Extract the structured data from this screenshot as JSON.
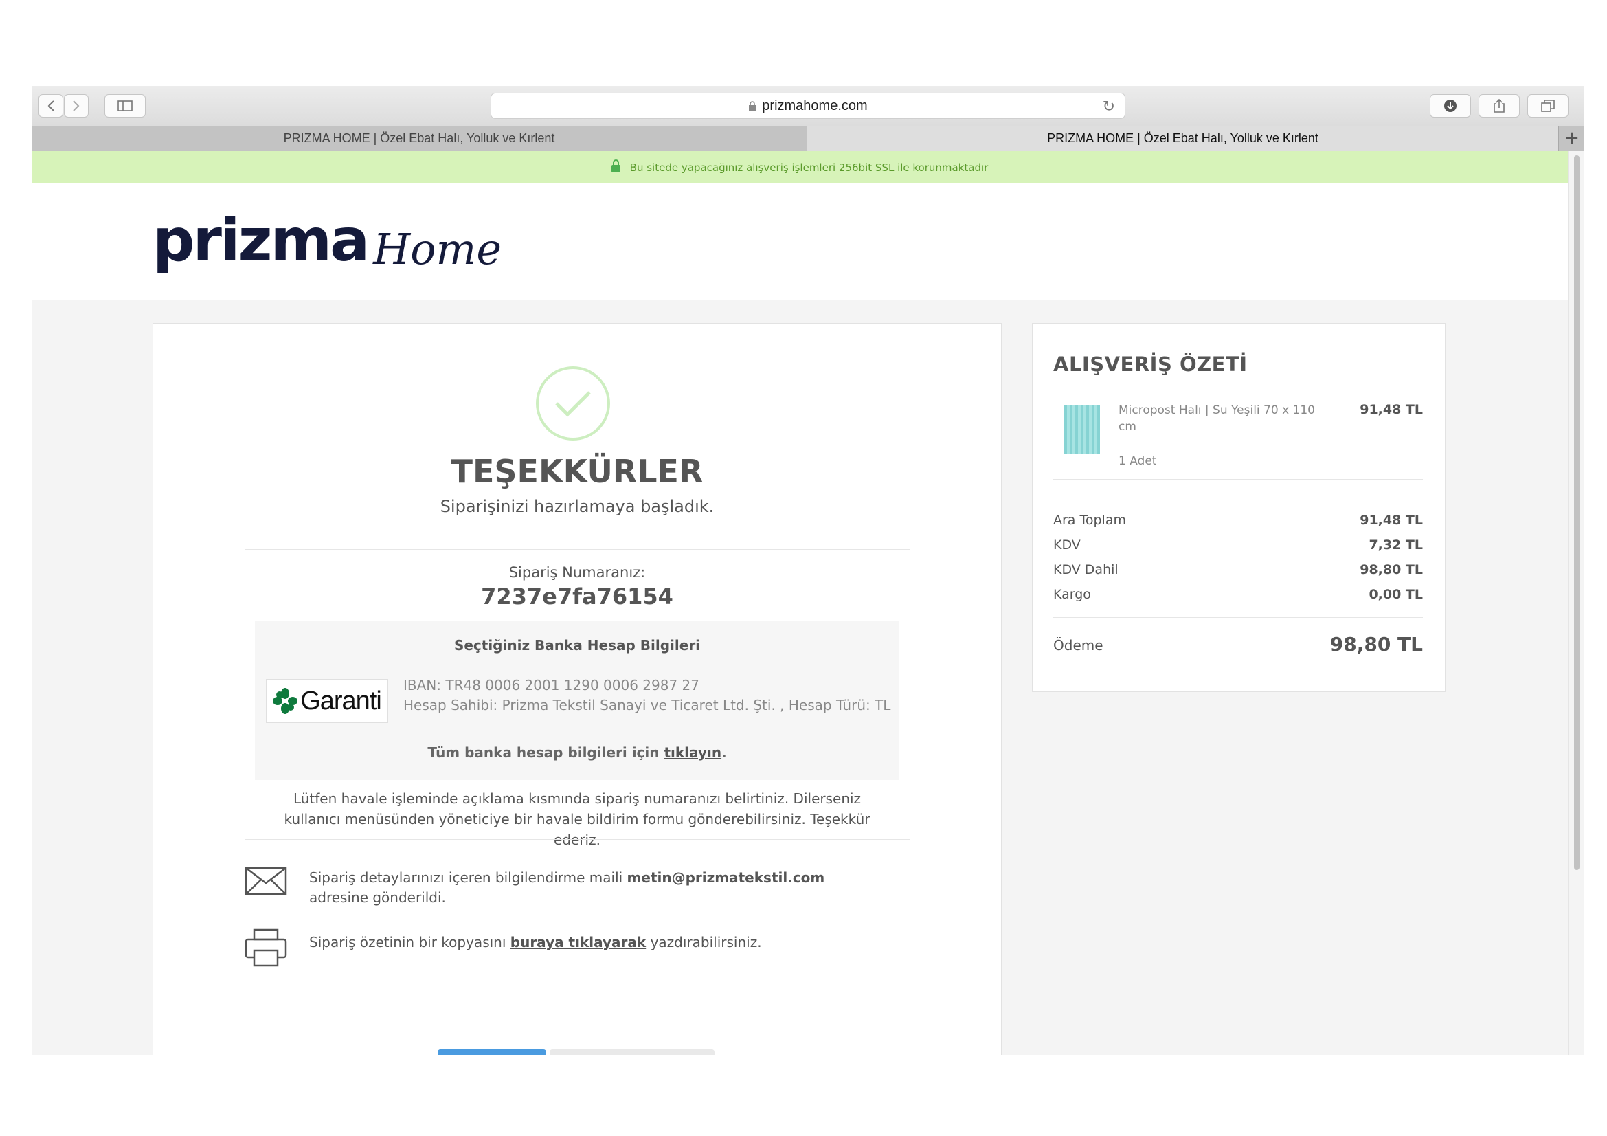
{
  "browser": {
    "url": "prizmahome.com",
    "tabs": [
      {
        "title": "PRIZMA HOME | Özel Ebat Halı, Yolluk ve Kırlent",
        "active": false
      },
      {
        "title": "PRIZMA HOME | Özel Ebat Halı, Yolluk ve Kırlent",
        "active": true
      }
    ],
    "new_tab_symbol": "+"
  },
  "ssl_notice": "Bu sitede yapacağınız alışveriş işlemleri 256bit SSL ile korunmaktadır",
  "logo": {
    "brand": "prizma",
    "sub": "Home"
  },
  "confirmation": {
    "title": "TEŞEKKÜRLER",
    "subtitle": "Siparişinizi hazırlamaya başladık.",
    "order_label": "Sipariş Numaranız:",
    "order_number": "7237e7fa76154"
  },
  "bank": {
    "title": "Seçtiğiniz Banka Hesap Bilgileri",
    "bank_name": "Garanti",
    "iban": "IBAN: TR48 0006 2001 1290 0006 2987 27",
    "holder": "Hesap Sahibi: Prizma Tekstil Sanayi ve Ticaret Ltd. Şti. , Hesap Türü: TL",
    "all_accounts_prefix": "Tüm banka hesap bilgileri için ",
    "all_accounts_link": "tıklayın",
    "all_accounts_suffix": "."
  },
  "note": "Lütfen havale işleminde açıklama kısmında sipariş numaranızı belirtiniz. Dilerseniz kullanıcı menüsünden yöneticiye bir havale bildirim formu gönderebilirsiniz. Teşekkür ederiz.",
  "mail_info": {
    "prefix": "Sipariş detaylarınızı içeren bilgilendirme maili ",
    "email": "metin@prizmatekstil.com",
    "suffix": " adresine gönderildi."
  },
  "print_info": {
    "prefix": "Sipariş özetinin bir kopyasını ",
    "link": "buraya tıklayarak",
    "suffix": " yazdırabilirsiniz."
  },
  "summary": {
    "title": "ALIŞVERİŞ ÖZETİ",
    "product": {
      "name": "Micropost Halı | Su Yeşili 70 x 110 cm",
      "qty": "1 Adet",
      "price": "91,48 TL"
    },
    "rows": [
      {
        "label": "Ara Toplam",
        "value": "91,48 TL"
      },
      {
        "label": "KDV",
        "value": "7,32 TL"
      },
      {
        "label": "KDV Dahil",
        "value": "98,80 TL"
      },
      {
        "label": "Kargo",
        "value": "0,00 TL"
      }
    ],
    "total": {
      "label": "Ödeme",
      "value": "98,80 TL"
    }
  },
  "colors": {
    "ssl_bg": "#d7f3b9",
    "check": "#cdeec0",
    "brand": "#141a3a",
    "button_blue": "#4a9be0"
  }
}
